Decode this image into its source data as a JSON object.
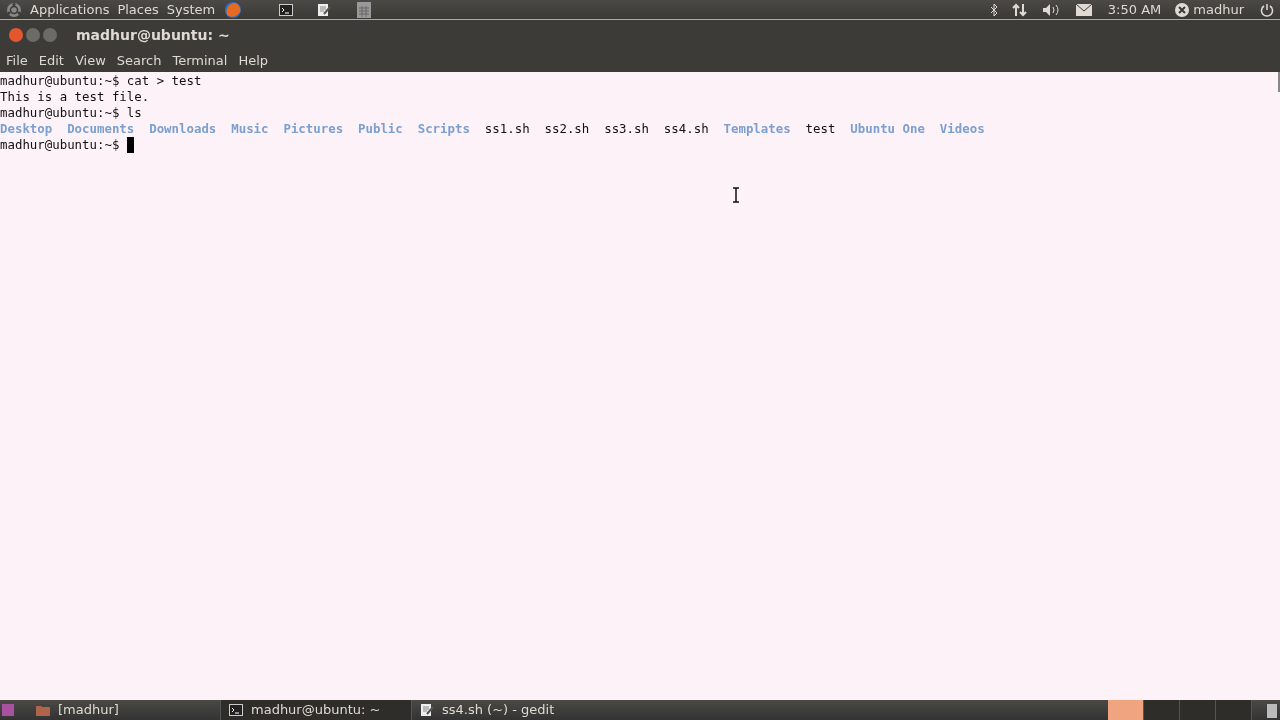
{
  "top_panel": {
    "menus": [
      "Applications",
      "Places",
      "System"
    ],
    "clock": "3:50 AM",
    "user": "madhur"
  },
  "window": {
    "title": "madhur@ubuntu: ~"
  },
  "menu_bar": [
    "File",
    "Edit",
    "View",
    "Search",
    "Terminal",
    "Help"
  ],
  "terminal": {
    "lines": [
      {
        "kind": "text",
        "text": "madhur@ubuntu:~$ cat > test"
      },
      {
        "kind": "text",
        "text": "This is a test file."
      },
      {
        "kind": "text",
        "text": "madhur@ubuntu:~$ ls"
      },
      {
        "kind": "listing",
        "entries": [
          {
            "name": "Desktop",
            "kind": "dir"
          },
          {
            "name": "Documents",
            "kind": "dir"
          },
          {
            "name": "Downloads",
            "kind": "dir"
          },
          {
            "name": "Music",
            "kind": "dir"
          },
          {
            "name": "Pictures",
            "kind": "dir"
          },
          {
            "name": "Public",
            "kind": "dir"
          },
          {
            "name": "Scripts",
            "kind": "dir"
          },
          {
            "name": "ss1.sh",
            "kind": "file"
          },
          {
            "name": "ss2.sh",
            "kind": "file"
          },
          {
            "name": "ss3.sh",
            "kind": "file"
          },
          {
            "name": "ss4.sh",
            "kind": "file"
          },
          {
            "name": "Templates",
            "kind": "dir"
          },
          {
            "name": "test",
            "kind": "file"
          },
          {
            "name": "Ubuntu One",
            "kind": "dir"
          },
          {
            "name": "Videos",
            "kind": "dir"
          }
        ]
      },
      {
        "kind": "prompt",
        "text": "madhur@ubuntu:~$"
      }
    ]
  },
  "taskbar": {
    "items": [
      {
        "label": "[madhur]",
        "kind": "folder",
        "selected": false
      },
      {
        "label": "madhur@ubuntu: ~",
        "kind": "terminal",
        "selected": true
      },
      {
        "label": "ss4.sh (~) - gedit",
        "kind": "editor",
        "selected": false
      }
    ],
    "workspaces": [
      {
        "selected": true
      },
      {
        "selected": false
      },
      {
        "selected": false
      },
      {
        "selected": false
      }
    ]
  }
}
